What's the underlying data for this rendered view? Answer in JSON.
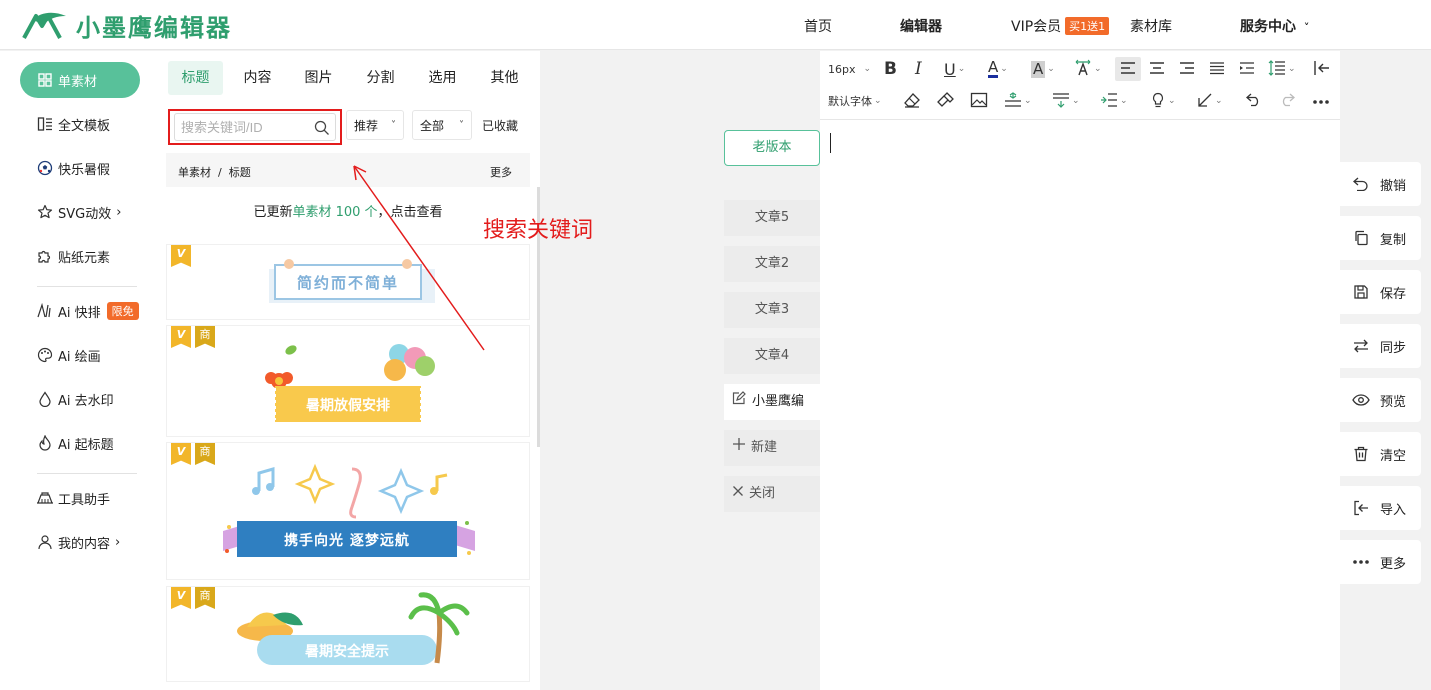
{
  "app": {
    "brand": "小墨鹰编辑器"
  },
  "nav": {
    "home": "首页",
    "editor": "编辑器",
    "vip": "VIP会员",
    "vip_badge": "买1送1",
    "library": "素材库",
    "service": "服务中心",
    "chevron": "˅"
  },
  "sidebar": {
    "items": [
      {
        "label": "单素材"
      },
      {
        "label": "全文模板"
      },
      {
        "label": "快乐暑假"
      },
      {
        "label": "SVG动效"
      },
      {
        "label": "贴纸元素"
      },
      {
        "label": "Ai 快排",
        "badge": "限免"
      },
      {
        "label": "Ai 绘画"
      },
      {
        "label": "Ai 去水印"
      },
      {
        "label": "Ai 起标题"
      },
      {
        "label": "工具助手"
      },
      {
        "label": "我的内容"
      }
    ],
    "chevron": "›"
  },
  "panel": {
    "tabs": [
      "标题",
      "内容",
      "图片",
      "分割",
      "选用",
      "其他"
    ],
    "search_placeholder": "搜索关键词/ID",
    "filter_sort": "推荐",
    "filter_scope": "全部",
    "filter_dropdown": "˅",
    "favorites": "已收藏",
    "breadcrumb": "单素材  /  标题",
    "more": "更多",
    "update_prefix": "已更新",
    "update_highlight": "单素材 100 个",
    "update_suffix": "，点击查看",
    "tag_v": "V",
    "tag_shang": "商",
    "cards": [
      {
        "title": "简约而不简单"
      },
      {
        "title": "暑期放假安排"
      },
      {
        "title": "携手向光 逐梦远航"
      },
      {
        "title": "暑期安全提示"
      }
    ]
  },
  "docs": {
    "old_version": "老版本",
    "tabs": [
      "文章5",
      "文章2",
      "文章3",
      "文章4"
    ],
    "current": "小墨鹰编",
    "new": "新建",
    "close": "关闭"
  },
  "editor": {
    "font_size": "16px",
    "font_family": "默认字体",
    "bold": "B",
    "italic": "I",
    "underline": "U",
    "font_color": "A",
    "bg_color": "A",
    "dropdown": "⌄"
  },
  "rail": {
    "items": [
      "撤销",
      "复制",
      "保存",
      "同步",
      "预览",
      "清空",
      "导入",
      "更多"
    ]
  },
  "annotation": {
    "label": "搜索关键词"
  },
  "colors": {
    "brand": "#2f9e6e",
    "accent": "#58c19a",
    "highlight_box": "#e31c1c",
    "badge": "#f26b2a"
  }
}
